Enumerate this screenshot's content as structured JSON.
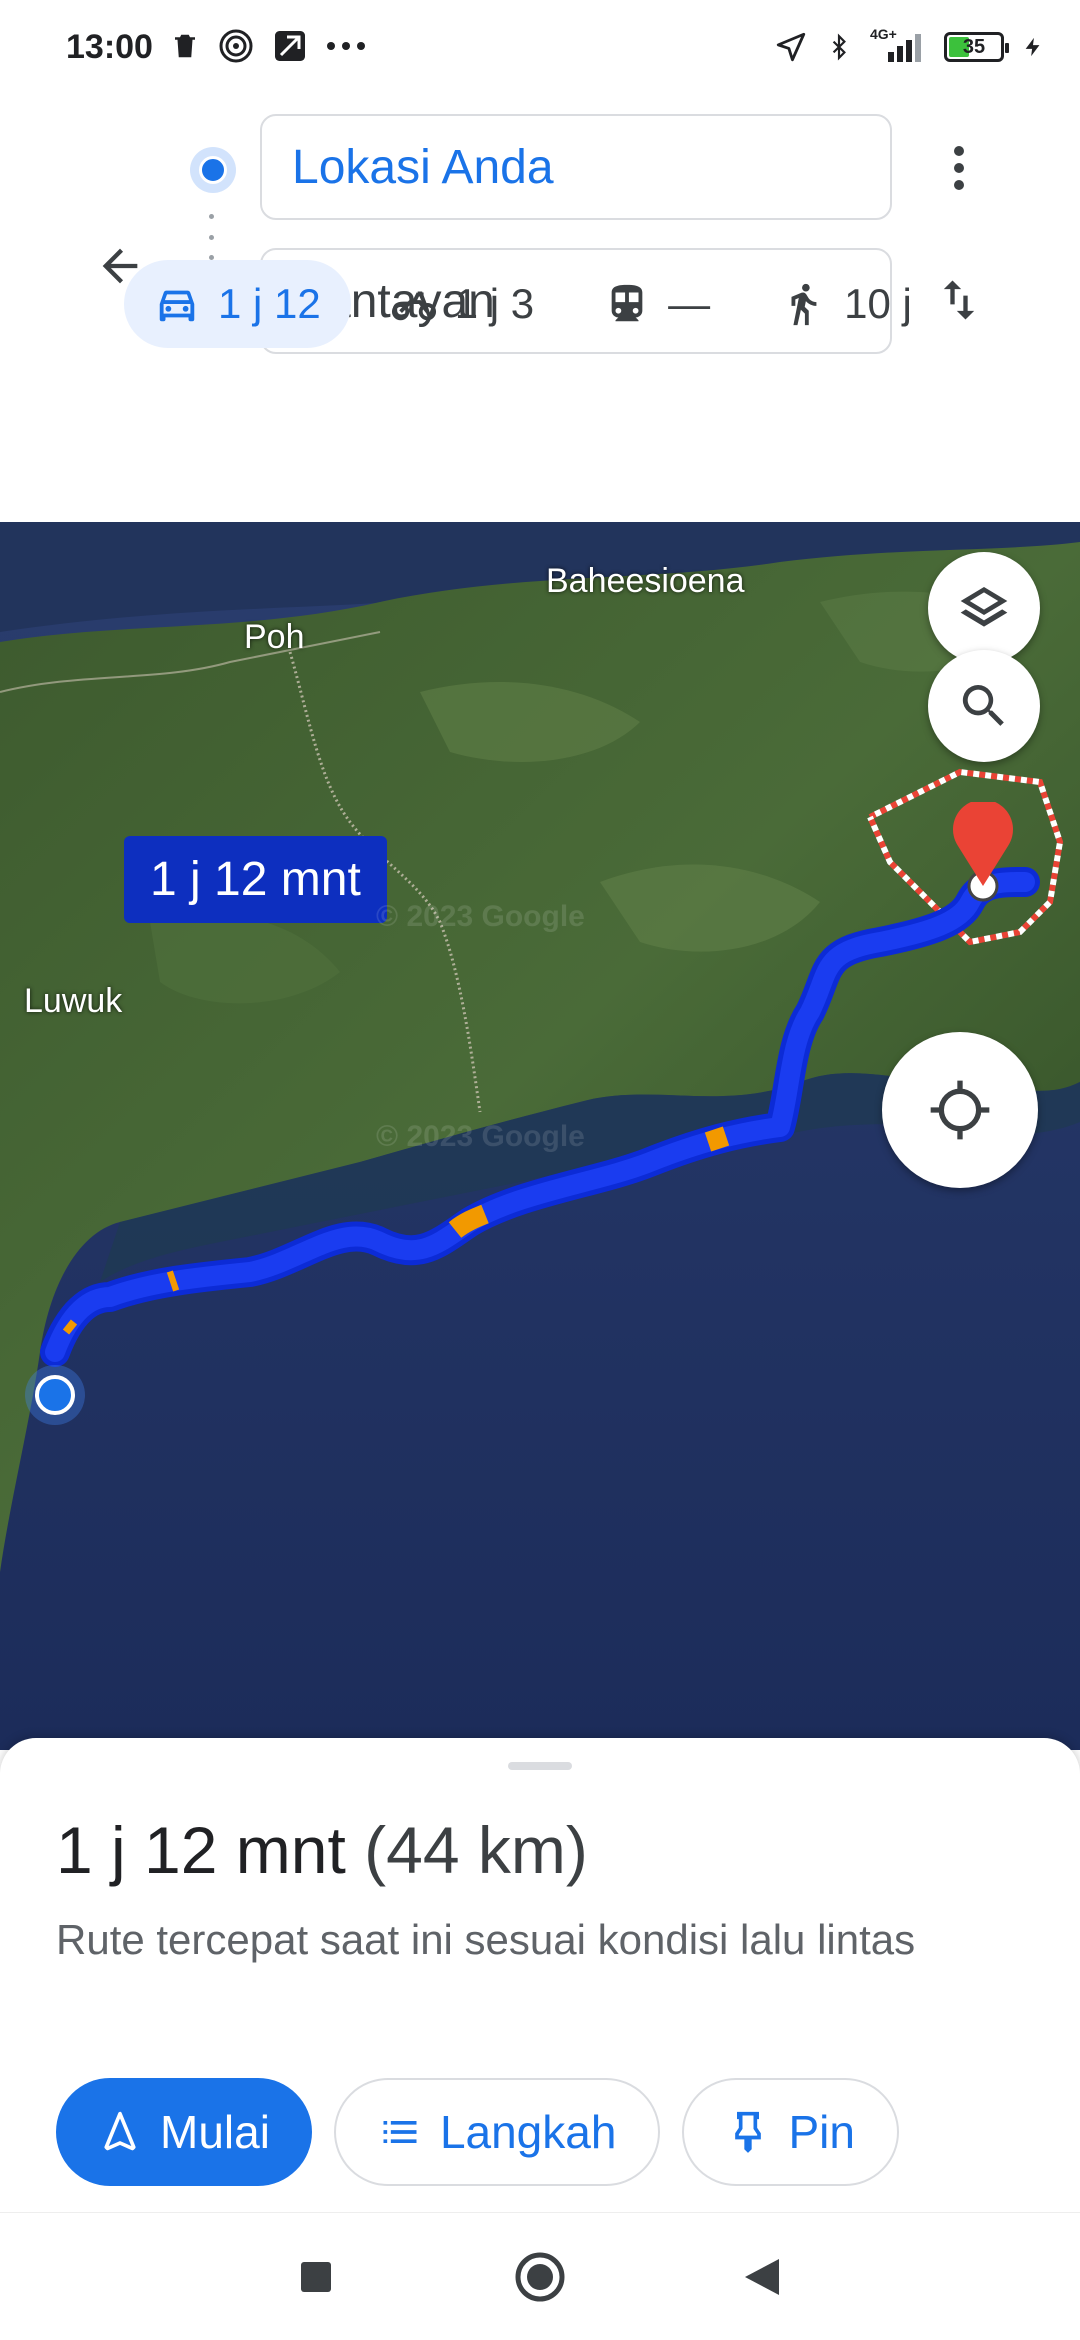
{
  "status_bar": {
    "time": "13:00",
    "battery": "35",
    "network": "4G+",
    "icons": [
      "trash-icon",
      "nfc-icon",
      "screenshot-icon",
      "more-dots-icon",
      "location-arrow-icon",
      "bluetooth-icon",
      "signal-icon",
      "battery-icon",
      "charging-icon"
    ]
  },
  "directions": {
    "origin": "Lokasi Anda",
    "destination": "Bantayan"
  },
  "modes": [
    {
      "name": "car",
      "label": "1 j 12",
      "active": true
    },
    {
      "name": "motorcycle",
      "label": "1 j 3",
      "active": false
    },
    {
      "name": "transit",
      "label": "—",
      "active": false
    },
    {
      "name": "walk",
      "label": "10 j",
      "active": false
    }
  ],
  "map": {
    "labels": {
      "baheesioena": "Baheesioena",
      "poh": "Poh",
      "luwuk": "Luwuk"
    },
    "eta": "1 j 12 mnt",
    "watermark": "© 2023 Google",
    "route_color": "#1a3cf0",
    "traffic_color": "#f29900"
  },
  "sheet": {
    "duration": "1 j 12 mnt",
    "distance": "(44 km)",
    "subtitle": "Rute tercepat saat ini sesuai kondisi lalu lintas",
    "start": "Mulai",
    "steps": "Langkah",
    "pin": "Pin"
  },
  "colors": {
    "accent": "#1a73e8",
    "destination_pin": "#ea4335"
  }
}
